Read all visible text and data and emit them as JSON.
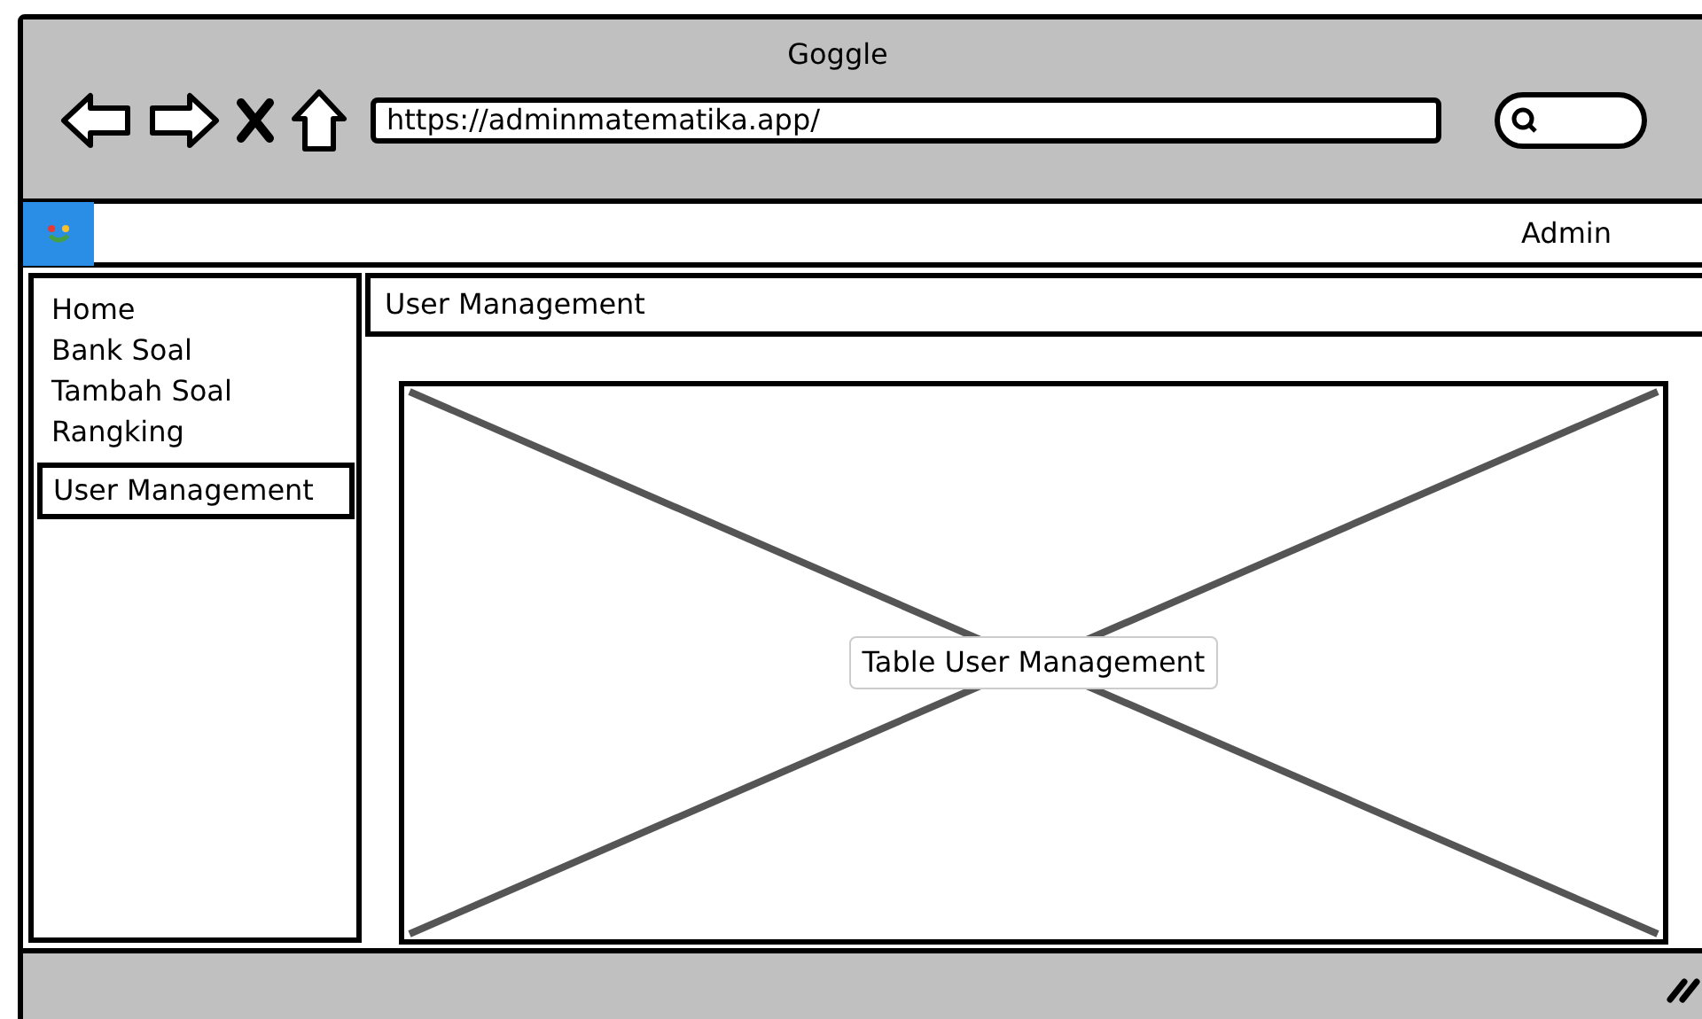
{
  "browser": {
    "title": "Goggle",
    "url": "https://adminmatematika.app/"
  },
  "app_bar": {
    "user": "Admin"
  },
  "sidebar": {
    "items": [
      {
        "label": "Home",
        "selected": false
      },
      {
        "label": "Bank Soal",
        "selected": false
      },
      {
        "label": "Tambah Soal",
        "selected": false
      },
      {
        "label": "Rangking",
        "selected": false
      },
      {
        "label": "User Management",
        "selected": true
      }
    ]
  },
  "main": {
    "heading": "User Management",
    "placeholder_label": "Table User Management"
  }
}
